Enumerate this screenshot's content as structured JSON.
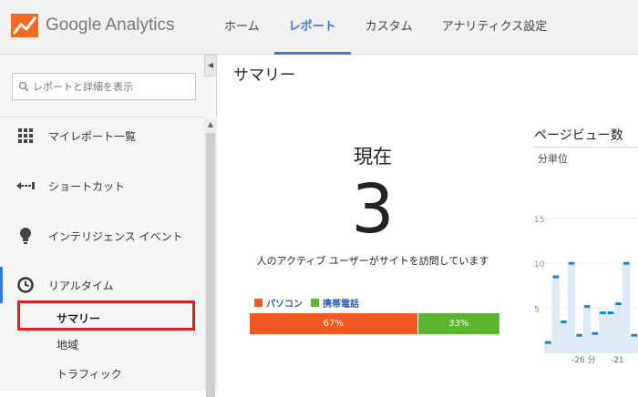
{
  "header": {
    "logo_text": "Google Analytics",
    "nav": [
      {
        "label": "ホーム",
        "active": false
      },
      {
        "label": "レポート",
        "active": true
      },
      {
        "label": "カスタム",
        "active": false
      },
      {
        "label": "アナリティクス設定",
        "active": false
      }
    ]
  },
  "sidebar": {
    "search_placeholder": "レポートと詳細を表示",
    "items": [
      {
        "label": "マイレポート一覧",
        "icon": "grid-icon"
      },
      {
        "label": "ショートカット",
        "icon": "shortcut-icon"
      },
      {
        "label": "インテリジェンス イベント",
        "icon": "lightbulb-icon"
      },
      {
        "label": "リアルタイム",
        "icon": "clock-icon",
        "active": true
      }
    ],
    "subitems": [
      {
        "label": "サマリー",
        "selected": true
      },
      {
        "label": "地域"
      },
      {
        "label": "トラフィック"
      }
    ]
  },
  "main": {
    "title": "サマリー",
    "now_label": "現在",
    "active_count": "3",
    "active_text": "人のアクティブ ユーザーがサイトを訪問しています",
    "legend": [
      {
        "label": "パソコン",
        "color": "#f05a22"
      },
      {
        "label": "携帯電話",
        "color": "#5cb531"
      }
    ],
    "device_split": [
      {
        "label": "67%",
        "value": 67,
        "color": "#f05a22"
      },
      {
        "label": "33%",
        "value": 33,
        "color": "#5cb531"
      }
    ]
  },
  "colors": {
    "accent": "#3c78d8",
    "highlight": "#e02020"
  },
  "chart_data": {
    "type": "bar",
    "title": "ページビュー数",
    "subtitle": "分単位",
    "y_ticks": [
      "15",
      "10",
      "5"
    ],
    "x_ticks": [
      "-26 分",
      "-21"
    ],
    "ylim": [
      0,
      17
    ],
    "values": [
      1.2,
      8.5,
      3.5,
      10,
      2,
      5.2,
      2.2,
      4.5,
      4.5,
      5.5,
      10,
      2
    ]
  }
}
